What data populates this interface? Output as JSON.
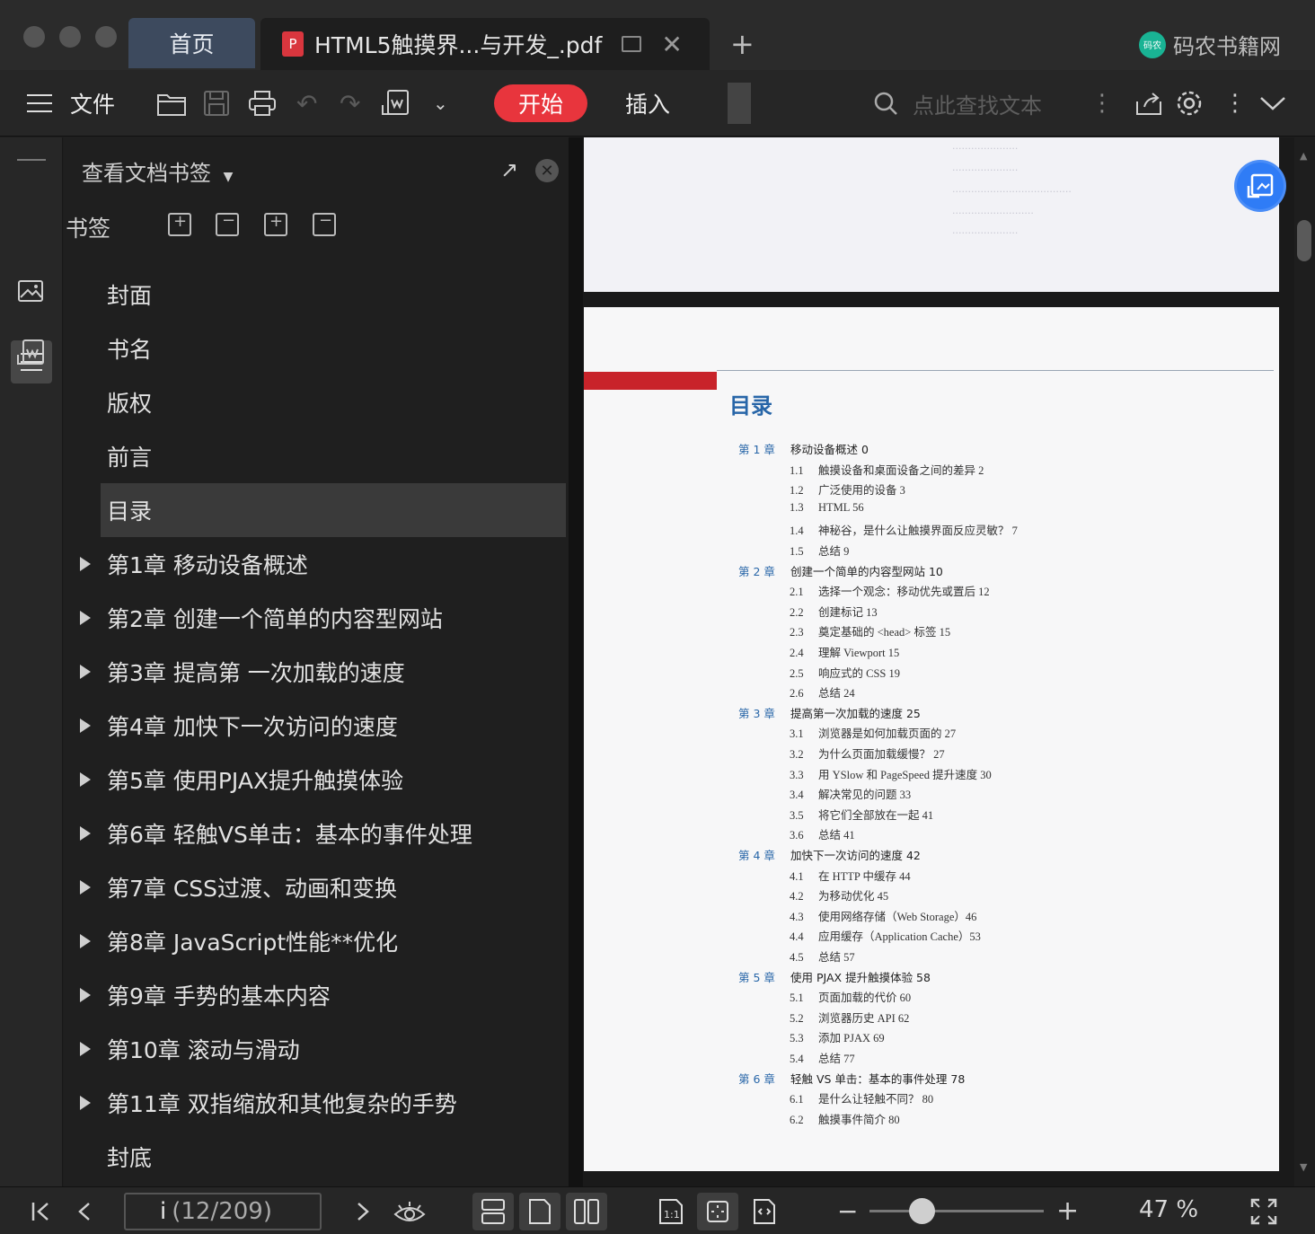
{
  "window": {
    "home_tab": "首页",
    "doc_tab_title": "HTML5触摸界...与开发_.pdf",
    "pdf_badge": "P",
    "new_tab": "+",
    "brand": "码农书籍网",
    "brand_logo_text": "码农"
  },
  "toolbar": {
    "file_label": "文件",
    "start_label": "开始",
    "insert_label": "插入",
    "search_placeholder": "点此查找文本"
  },
  "sidebar": {
    "header": "查看文档书签",
    "bookmarks_label": "书签",
    "items": [
      {
        "label": "封面",
        "expandable": false,
        "active": false
      },
      {
        "label": "书名",
        "expandable": false,
        "active": false
      },
      {
        "label": "版权",
        "expandable": false,
        "active": false
      },
      {
        "label": "前言",
        "expandable": false,
        "active": false
      },
      {
        "label": "目录",
        "expandable": false,
        "active": true
      },
      {
        "label": "第1章 移动设备概述",
        "expandable": true,
        "active": false
      },
      {
        "label": "第2章 创建一个简单的内容型网站",
        "expandable": true,
        "active": false
      },
      {
        "label": "第3章 提高第 一次加载的速度",
        "expandable": true,
        "active": false
      },
      {
        "label": "第4章 加快下一次访问的速度",
        "expandable": true,
        "active": false
      },
      {
        "label": "第5章 使用PJAX提升触摸体验",
        "expandable": true,
        "active": false
      },
      {
        "label": "第6章 轻触VS单击：基本的事件处理",
        "expandable": true,
        "active": false
      },
      {
        "label": "第7章 CSS过渡、动画和变换",
        "expandable": true,
        "active": false
      },
      {
        "label": "第8章 JavaScript性能**优化",
        "expandable": true,
        "active": false
      },
      {
        "label": "第9章 手势的基本内容",
        "expandable": true,
        "active": false
      },
      {
        "label": "第10章 滚动与滑动",
        "expandable": true,
        "active": false
      },
      {
        "label": "第11章 双指缩放和其他复杂的手势",
        "expandable": true,
        "active": false
      },
      {
        "label": "封底",
        "expandable": false,
        "active": false
      }
    ]
  },
  "document": {
    "toc_title": "目录",
    "toc": [
      {
        "type": "chapter",
        "ch": "第 1 章",
        "text": "移动设备概述 0"
      },
      {
        "type": "section",
        "num": "1.1",
        "text": "触摸设备和桌面设备之间的差异 2"
      },
      {
        "type": "section",
        "num": "1.2",
        "text": "广泛使用的设备 3"
      },
      {
        "type": "section",
        "num": "1.3",
        "text": "HTML 56"
      },
      {
        "type": "section",
        "num": "1.4",
        "text": "神秘谷，是什么让触摸界面反应灵敏？ 7"
      },
      {
        "type": "section",
        "num": "1.5",
        "text": "总结 9"
      },
      {
        "type": "chapter",
        "ch": "第 2 章",
        "text": "创建一个简单的内容型网站 10"
      },
      {
        "type": "section",
        "num": "2.1",
        "text": "选择一个观念：移动优先或置后 12"
      },
      {
        "type": "section",
        "num": "2.2",
        "text": "创建标记 13"
      },
      {
        "type": "section",
        "num": "2.3",
        "text": "奠定基础的 <head> 标签 15"
      },
      {
        "type": "section",
        "num": "2.4",
        "text": "理解 Viewport 15"
      },
      {
        "type": "section",
        "num": "2.5",
        "text": "响应式的 CSS 19"
      },
      {
        "type": "section",
        "num": "2.6",
        "text": "总结 24"
      },
      {
        "type": "chapter",
        "ch": "第 3 章",
        "text": "提高第一次加载的速度 25"
      },
      {
        "type": "section",
        "num": "3.1",
        "text": "浏览器是如何加载页面的 27"
      },
      {
        "type": "section",
        "num": "3.2",
        "text": "为什么页面加载缓慢？ 27"
      },
      {
        "type": "section",
        "num": "3.3",
        "text": "用 YSlow 和 PageSpeed 提升速度 30"
      },
      {
        "type": "section",
        "num": "3.4",
        "text": "解决常见的问题 33"
      },
      {
        "type": "section",
        "num": "3.5",
        "text": "将它们全部放在一起 41"
      },
      {
        "type": "section",
        "num": "3.6",
        "text": "总结 41"
      },
      {
        "type": "chapter",
        "ch": "第 4 章",
        "text": "加快下一次访问的速度 42"
      },
      {
        "type": "section",
        "num": "4.1",
        "text": "在 HTTP 中缓存 44"
      },
      {
        "type": "section",
        "num": "4.2",
        "text": "为移动优化 45"
      },
      {
        "type": "section",
        "num": "4.3",
        "text": "使用网络存储（Web Storage）46"
      },
      {
        "type": "section",
        "num": "4.4",
        "text": "应用缓存（Application Cache）53"
      },
      {
        "type": "section",
        "num": "4.5",
        "text": "总结 57"
      },
      {
        "type": "chapter",
        "ch": "第 5 章",
        "text": "使用 PJAX 提升触摸体验 58"
      },
      {
        "type": "section",
        "num": "5.1",
        "text": "页面加载的代价 60"
      },
      {
        "type": "section",
        "num": "5.2",
        "text": "浏览器历史 API 62"
      },
      {
        "type": "section",
        "num": "5.3",
        "text": "添加 PJAX 69"
      },
      {
        "type": "section",
        "num": "5.4",
        "text": "总结 77"
      },
      {
        "type": "chapter",
        "ch": "第 6 章",
        "text": "轻触 VS 单击：基本的事件处理 78"
      },
      {
        "type": "section",
        "num": "6.1",
        "text": "是什么让轻触不同？ 80"
      },
      {
        "type": "section",
        "num": "6.2",
        "text": "触摸事件简介 80"
      }
    ]
  },
  "status": {
    "page_cursor": "i",
    "page_info": "(12/209)",
    "zoom": "47 %",
    "zoom_fraction": 0.3
  },
  "colors": {
    "accent": "#e8353d",
    "toc_blue": "#2866a8",
    "float_button": "#2f7cf6"
  }
}
